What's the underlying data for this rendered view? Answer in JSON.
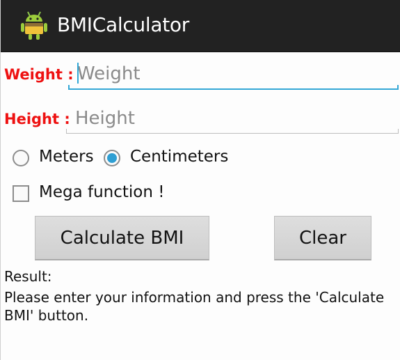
{
  "app": {
    "title": "BMICalculator",
    "icon": "android-robot-icon"
  },
  "form": {
    "weight_label": "Weight :",
    "weight_placeholder": "Weight",
    "weight_value": "",
    "height_label": "Height :",
    "height_placeholder": "Height",
    "height_value": ""
  },
  "units": {
    "options": [
      "Meters",
      "Centimeters"
    ],
    "selected": "Centimeters"
  },
  "mega": {
    "label": "Mega function !",
    "checked": false
  },
  "buttons": {
    "calculate": "Calculate BMI",
    "clear": "Clear"
  },
  "result": {
    "label": "Result:",
    "message": "Please enter your information and press the 'Calculate BMI' button."
  },
  "colors": {
    "action_bar": "#222222",
    "label_red": "#ee1111",
    "accent_blue": "#33a7d6"
  }
}
